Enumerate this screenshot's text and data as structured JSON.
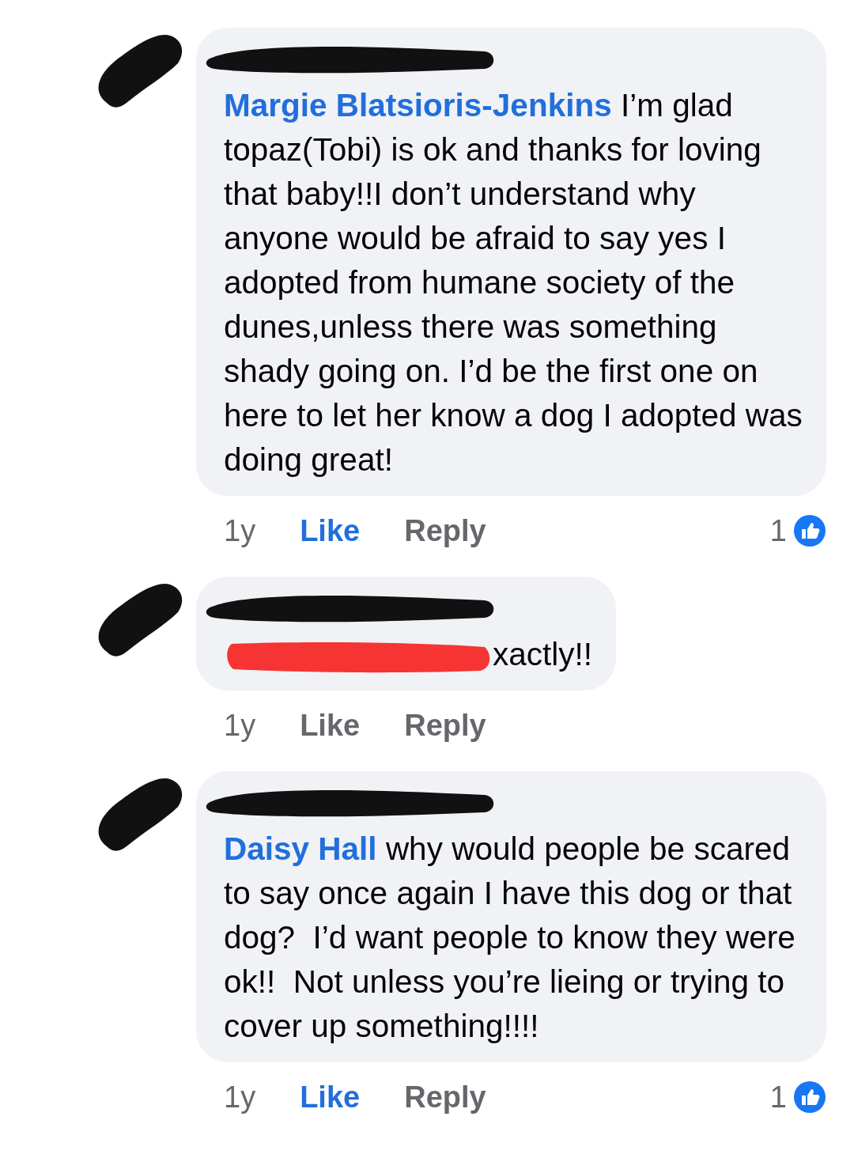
{
  "comments": [
    {
      "mention": "Margie Blatsioris-Jenkins",
      "text": "I’m glad topaz(Tobi) is ok and thanks for loving that baby!!I don’t understand why anyone would be afraid to say yes I adopted from humane society of the dunes,unless there was something shady going on. I’d be the first one on here to let her know a dog I adopted was doing great!",
      "text_redacted": false,
      "time": "1y",
      "like": {
        "label": "Like",
        "selected": true
      },
      "reply": "Reply",
      "reaction_count": "1"
    },
    {
      "text": "xactly!!",
      "text_redacted": true,
      "time": "1y",
      "like": {
        "label": "Like",
        "selected": false
      },
      "reply": "Reply"
    },
    {
      "mention": "Daisy Hall",
      "text": "why would people be scared to say once again I have this dog or that dog?  I’d want people to know they were ok!!  Not unless you’re lieing or trying to cover up something!!!!",
      "text_redacted": false,
      "time": "1y",
      "like": {
        "label": "Like",
        "selected": true
      },
      "reply": "Reply",
      "reaction_count": "1"
    }
  ]
}
